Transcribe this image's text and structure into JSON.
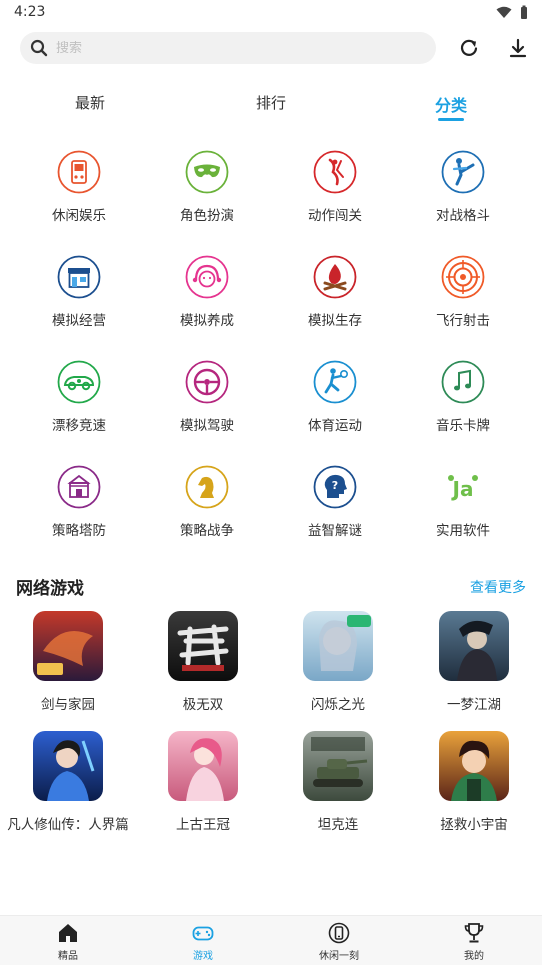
{
  "status_bar": {
    "time": "4:23"
  },
  "search": {
    "placeholder": "搜索"
  },
  "tabs": [
    {
      "label": "最新"
    },
    {
      "label": "排行"
    },
    {
      "label": "分类",
      "active": true
    }
  ],
  "categories": [
    {
      "label": "休闲娱乐",
      "icon": "gameboy-icon",
      "color": "#e8552f"
    },
    {
      "label": "角色扮演",
      "icon": "mask-icon",
      "color": "#6ab23a"
    },
    {
      "label": "动作闯关",
      "icon": "action-figure-icon",
      "color": "#d6282b"
    },
    {
      "label": "对战格斗",
      "icon": "kick-fighter-icon",
      "color": "#1e6fb4"
    },
    {
      "label": "模拟经营",
      "icon": "storefront-icon",
      "color": "#1c4f8f"
    },
    {
      "label": "模拟养成",
      "icon": "girl-face-icon",
      "color": "#e5348f"
    },
    {
      "label": "模拟生存",
      "icon": "campfire-icon",
      "color": "#c9242a"
    },
    {
      "label": "飞行射击",
      "icon": "target-icon",
      "color": "#f05a28"
    },
    {
      "label": "漂移竞速",
      "icon": "race-car-icon",
      "color": "#22a84a"
    },
    {
      "label": "模拟驾驶",
      "icon": "steering-wheel-icon",
      "color": "#b5267e"
    },
    {
      "label": "体育运动",
      "icon": "tennis-player-icon",
      "color": "#1a8fd0"
    },
    {
      "label": "音乐卡牌",
      "icon": "music-note-icon",
      "color": "#2e8b57"
    },
    {
      "label": "策略塔防",
      "icon": "tower-icon",
      "color": "#8a2a88"
    },
    {
      "label": "策略战争",
      "icon": "chess-knight-icon",
      "color": "#d6a41a"
    },
    {
      "label": "益智解谜",
      "icon": "brain-puzzle-icon",
      "color": "#1c4f8f"
    },
    {
      "label": "实用软件",
      "icon": "apps-letters-icon",
      "color": "#4caf50"
    }
  ],
  "online_section": {
    "title": "网络游戏",
    "more": "查看更多"
  },
  "games": [
    {
      "name": "剑与家园",
      "thumb_top": "#c4392a",
      "thumb_bottom": "#2b1a3a"
    },
    {
      "name": "极无双",
      "thumb_top": "#3a3a3a",
      "thumb_bottom": "#0d0d0d"
    },
    {
      "name": "闪烁之光",
      "thumb_top": "#cfe3ee",
      "thumb_bottom": "#7aa7c7"
    },
    {
      "name": "一梦江湖",
      "thumb_top": "#5a7a93",
      "thumb_bottom": "#1f2d3d"
    },
    {
      "name": "凡人修仙传：人界篇",
      "thumb_top": "#2d5fd0",
      "thumb_bottom": "#0b1d4a"
    },
    {
      "name": "上古王冠",
      "thumb_top": "#f5b5c8",
      "thumb_bottom": "#c85a7c"
    },
    {
      "name": "坦克连",
      "thumb_top": "#9aa39b",
      "thumb_bottom": "#3d4a3d"
    },
    {
      "name": "拯救小宇宙",
      "thumb_top": "#e9a23b",
      "thumb_bottom": "#5a2418"
    }
  ],
  "bottom_nav": [
    {
      "label": "精品",
      "icon": "home-icon"
    },
    {
      "label": "游戏",
      "icon": "gamepad-icon",
      "active": true
    },
    {
      "label": "休闲一刻",
      "icon": "phone-game-icon"
    },
    {
      "label": "我的",
      "icon": "trophy-icon"
    }
  ],
  "colors": {
    "accent": "#1ba1e2"
  }
}
